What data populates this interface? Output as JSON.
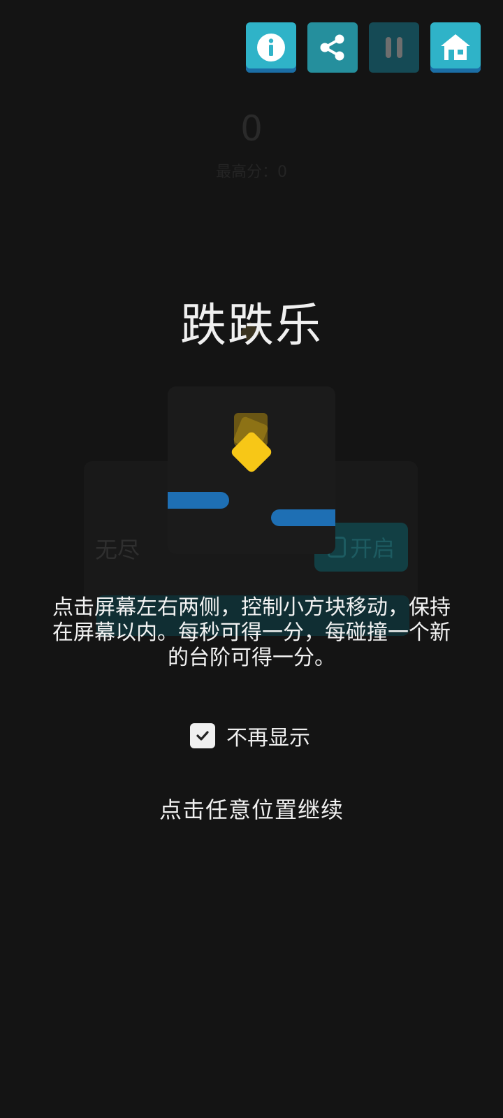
{
  "toolbar": {
    "buttons": [
      {
        "id": "info",
        "icon": "info-icon",
        "color": "#2fb3c8"
      },
      {
        "id": "share",
        "icon": "share-icon",
        "color": "#258f9d"
      },
      {
        "id": "pause",
        "icon": "pause-icon",
        "color": "#154a55"
      },
      {
        "id": "home",
        "icon": "home-icon",
        "color": "#2fb3c8"
      }
    ]
  },
  "background_ui": {
    "score": "0",
    "best_score": "最高分：0",
    "mode_label": "无尽",
    "mode_toggle_label": "开启"
  },
  "tutorial": {
    "title": "跌跌乐",
    "instructions": "点击屏幕左右两侧，控制小方块移动，保持在屏幕以内。每秒可得一分，每碰撞一个新的台阶可得一分。",
    "dont_show_again": {
      "label": "不再显示",
      "checked": true
    },
    "continue_hint": "点击任意位置继续",
    "preview": {
      "player_color": "#f7c717",
      "platform_color": "#1e6fb4"
    }
  }
}
